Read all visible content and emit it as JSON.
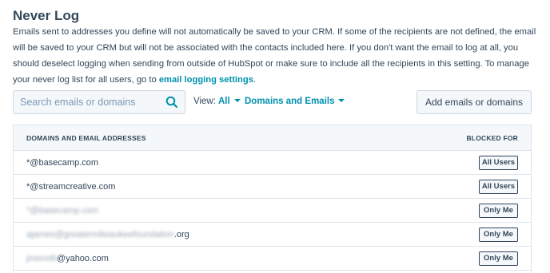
{
  "section": {
    "title": "Never Log",
    "description": "Emails sent to addresses you define will not automatically be saved to your CRM. If some of the recipients are not defined, the email will be saved to your CRM but will not be associated with the contacts included here. If you don't want the email to log at all, you should deselect logging when sending from outside of HubSpot or make sure to include all the recipients in this setting. To manage your never log list for all users, go to",
    "link_label": "email logging settings",
    "link_suffix": "."
  },
  "toolbar": {
    "search_placeholder": "Search emails or domains",
    "search_icon": "search-icon",
    "view_label": "View:",
    "view_filter": "All",
    "type_filter": "Domains and Emails",
    "add_button": "Add emails or domains"
  },
  "table": {
    "columns": [
      "DOMAINS AND EMAIL ADDRESSES",
      "BLOCKED FOR"
    ],
    "rows": [
      {
        "prefix": "",
        "email": "*@basecamp.com",
        "blocked_for": "All Users"
      },
      {
        "prefix": "",
        "email": "*@streamcreative.com",
        "blocked_for": "All Users"
      },
      {
        "prefix": "*@basecamp.com",
        "email": "",
        "blocked_for": "Only Me"
      },
      {
        "prefix": "ajames@greatermilwaukeefoundation",
        "email": ".org",
        "blocked_for": "Only Me"
      },
      {
        "prefix": "jmonolit",
        "email": "@yahoo.com",
        "blocked_for": "Only Me"
      }
    ]
  },
  "colors": {
    "text": "#33475b",
    "link": "#0091ae",
    "border": "#cbd6e2",
    "header_bg": "#f5f8fa"
  }
}
